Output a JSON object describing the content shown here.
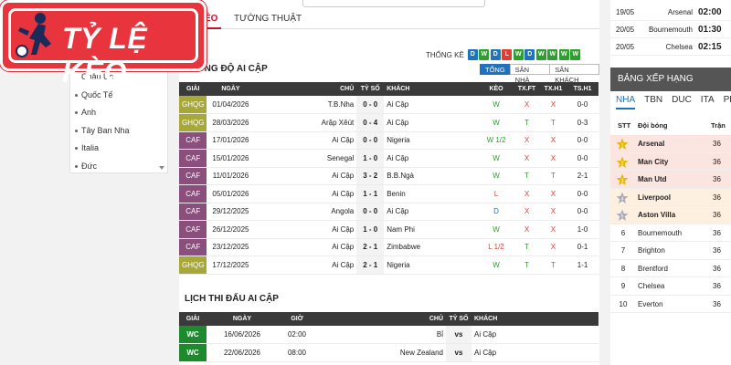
{
  "logo": {
    "text": "TỶ LỆ KÈO"
  },
  "tabs": {
    "active": "ÉO",
    "other": "TƯỜNG THUẬT"
  },
  "sidebar": {
    "items": [
      "Châu Úc",
      "Quốc Tế",
      "Anh",
      "Tây Ban Nha",
      "Italia",
      "Đức"
    ]
  },
  "stats": {
    "label": "THỐNG KÊ",
    "form": [
      "D",
      "W",
      "D",
      "L",
      "W",
      "D",
      "W",
      "W",
      "W",
      "W"
    ],
    "colors": {
      "W": "#2e9e2e",
      "D": "#1e73be",
      "L": "#e03c31"
    }
  },
  "filters": {
    "items": [
      "TỔNG",
      "SÂN NHÀ",
      "SÂN KHÁCH"
    ],
    "active": "TỔNG"
  },
  "form_section": {
    "title": "PHONG ĐỘ AI CẬP",
    "headers": [
      "GIẢI",
      "NGÀY",
      "CHỦ",
      "TỶ SỐ",
      "KHÁCH",
      "KÈO",
      "TX.FT",
      "TX.H1",
      "TS.H1"
    ],
    "rows": [
      {
        "comp": "GHQG",
        "date": "01/04/2026",
        "home": "T.B.Nha",
        "score": "0 - 0",
        "away": "Ai Cập",
        "keo": "W",
        "txft": "X",
        "txh1": "X",
        "tsh1": "0-0"
      },
      {
        "comp": "GHQG",
        "date": "28/03/2026",
        "home": "Arập Xêút",
        "score": "0 - 4",
        "away": "Ai Cập",
        "keo": "W",
        "txft": "T",
        "txh1": "T",
        "tsh1": "0-3"
      },
      {
        "comp": "CAF",
        "date": "17/01/2026",
        "home": "Ai Cập",
        "score": "0 - 0",
        "away": "Nigeria",
        "keo": "W 1/2",
        "txft": "X",
        "txh1": "X",
        "tsh1": "0-0"
      },
      {
        "comp": "CAF",
        "date": "15/01/2026",
        "home": "Senegal",
        "score": "1 - 0",
        "away": "Ai Cập",
        "keo": "W",
        "txft": "X",
        "txh1": "X",
        "tsh1": "0-0"
      },
      {
        "comp": "CAF",
        "date": "11/01/2026",
        "home": "Ai Cập",
        "score": "3 - 2",
        "away": "B.B.Ngà",
        "keo": "W",
        "txft": "T",
        "txh1": "T",
        "tsh1": "2-1"
      },
      {
        "comp": "CAF",
        "date": "05/01/2026",
        "home": "Ai Cập",
        "score": "1 - 1",
        "away": "Benin",
        "keo": "L",
        "txft": "X",
        "txh1": "X",
        "tsh1": "0-0"
      },
      {
        "comp": "CAF",
        "date": "29/12/2025",
        "home": "Angola",
        "score": "0 - 0",
        "away": "Ai Cập",
        "keo": "D",
        "txft": "X",
        "txh1": "X",
        "tsh1": "0-0"
      },
      {
        "comp": "CAF",
        "date": "26/12/2025",
        "home": "Ai Cập",
        "score": "1 - 0",
        "away": "Nam Phi",
        "keo": "W",
        "txft": "X",
        "txh1": "X",
        "tsh1": "1-0"
      },
      {
        "comp": "CAF",
        "date": "23/12/2025",
        "home": "Ai Cập",
        "score": "2 - 1",
        "away": "Zimbabwe",
        "keo": "L 1/2",
        "txft": "T",
        "txh1": "X",
        "tsh1": "0-1"
      },
      {
        "comp": "GHQG",
        "date": "17/12/2025",
        "home": "Ai Cập",
        "score": "2 - 1",
        "away": "Nigeria",
        "keo": "W",
        "txft": "T",
        "txh1": "T",
        "tsh1": "1-1"
      }
    ],
    "comp_colors": {
      "GHQG": "#a8a838",
      "CAF": "#8a4f7d"
    }
  },
  "schedule_section": {
    "title": "LỊCH THI ĐẤU AI CẬP",
    "headers": [
      "GIẢI",
      "NGÀY",
      "GIỜ",
      "CHỦ",
      "TỶ SỐ",
      "KHÁCH"
    ],
    "rows": [
      {
        "comp": "WC",
        "date": "16/06/2026",
        "time": "02:00",
        "home": "Bỉ",
        "score": "vs",
        "away": "Ai Cập"
      },
      {
        "comp": "WC",
        "date": "22/06/2026",
        "time": "08:00",
        "home": "New Zealand",
        "score": "vs",
        "away": "Ai Cập"
      }
    ],
    "comp_color": "#1e8a2e"
  },
  "fixtures": [
    {
      "date": "19/05",
      "team": "Arsenal",
      "time": "02:00"
    },
    {
      "date": "20/05",
      "team": "Bournemouth",
      "time": "01:30"
    },
    {
      "date": "20/05",
      "team": "Chelsea",
      "time": "02:15"
    }
  ],
  "standings": {
    "title": "BẢNG XẾP HẠNG",
    "leagues": [
      "NHA",
      "TBN",
      "DUC",
      "ITA",
      "PHA"
    ],
    "active_league": "NHA",
    "headers": {
      "pos": "STT",
      "team": "Đội bóng",
      "played": "Trận"
    },
    "rows": [
      {
        "pos": "1",
        "team": "Arsenal",
        "played": "36",
        "medal": "gold"
      },
      {
        "pos": "2",
        "team": "Man City",
        "played": "36",
        "medal": "gold"
      },
      {
        "pos": "3",
        "team": "Man Utd",
        "played": "36",
        "medal": "gold"
      },
      {
        "pos": "4",
        "team": "Liverpool",
        "played": "36",
        "medal": "silver"
      },
      {
        "pos": "5",
        "team": "Aston Villa",
        "played": "36",
        "medal": "silver"
      },
      {
        "pos": "6",
        "team": "Bournemouth",
        "played": "36",
        "medal": ""
      },
      {
        "pos": "7",
        "team": "Brighton",
        "played": "36",
        "medal": ""
      },
      {
        "pos": "8",
        "team": "Brentford",
        "played": "36",
        "medal": ""
      },
      {
        "pos": "9",
        "team": "Chelsea",
        "played": "36",
        "medal": ""
      },
      {
        "pos": "10",
        "team": "Everton",
        "played": "36",
        "medal": ""
      }
    ]
  }
}
